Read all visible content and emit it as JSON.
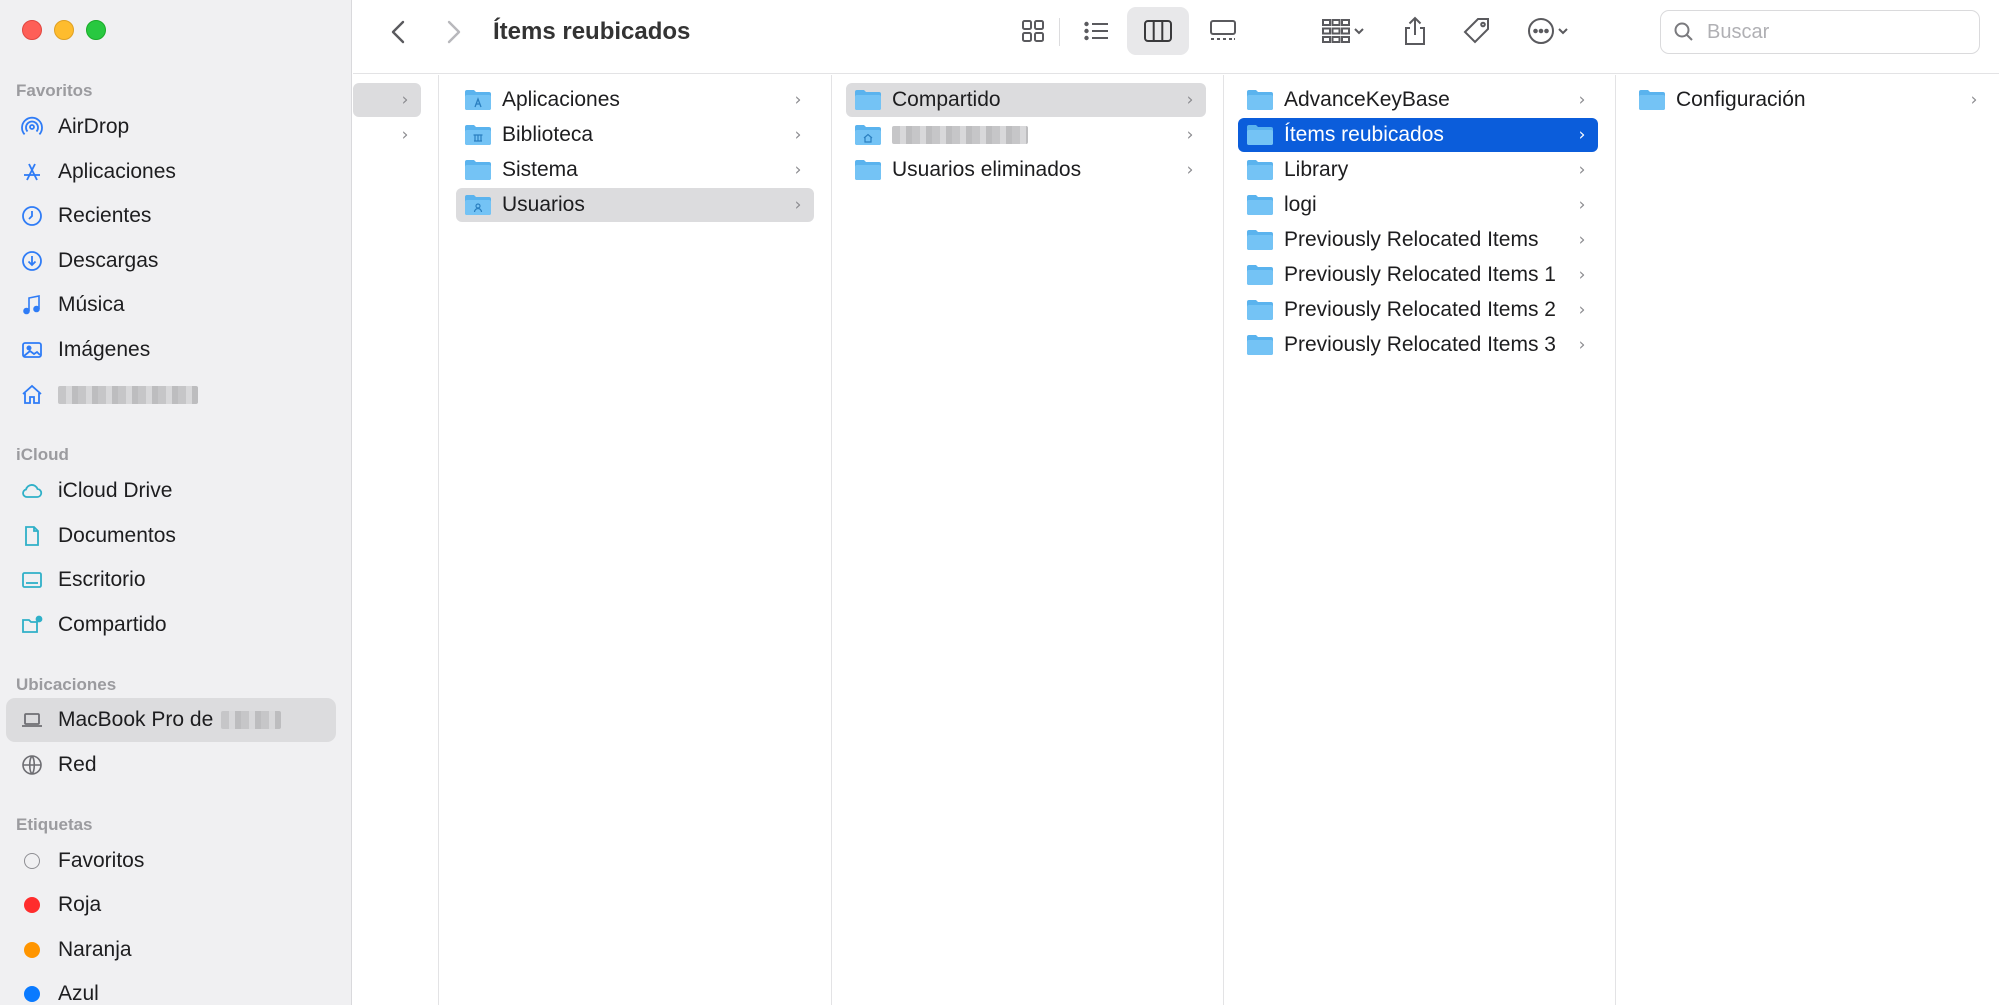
{
  "window": {
    "title": "Ítems reubicados"
  },
  "sidebar": {
    "sections": {
      "favorites": "Favoritos",
      "icloud": "iCloud",
      "locations": "Ubicaciones",
      "tags": "Etiquetas"
    },
    "favorites": [
      {
        "label": "AirDrop",
        "icon": "airdrop-icon"
      },
      {
        "label": "Aplicaciones",
        "icon": "applications-icon"
      },
      {
        "label": "Recientes",
        "icon": "clock-icon"
      },
      {
        "label": "Descargas",
        "icon": "download-icon"
      },
      {
        "label": "Música",
        "icon": "music-icon"
      },
      {
        "label": "Imágenes",
        "icon": "photo-icon"
      },
      {
        "label": "",
        "icon": "home-icon"
      }
    ],
    "icloud": [
      {
        "label": "iCloud Drive",
        "icon": "cloud-icon"
      },
      {
        "label": "Documentos",
        "icon": "document-icon"
      },
      {
        "label": "Escritorio",
        "icon": "desktop-icon"
      },
      {
        "label": "Compartido",
        "icon": "shared-folder-icon"
      }
    ],
    "locations": [
      {
        "label": "MacBook Pro de",
        "icon": "laptop-icon"
      },
      {
        "label": "Red",
        "icon": "network-icon"
      }
    ],
    "tags": [
      {
        "label": "Favoritos",
        "color": "none"
      },
      {
        "label": "Roja",
        "color": "#ff2d2d"
      },
      {
        "label": "Naranja",
        "color": "#ff9500"
      },
      {
        "label": "Azul",
        "color": "#0a7aff"
      }
    ]
  },
  "toolbar": {
    "back": "back-chevron-icon",
    "forward": "forward-chevron-icon",
    "view_modes": [
      "icon-view-icon",
      "list-view-icon",
      "column-view-icon",
      "gallery-view-icon"
    ],
    "active_view": "column-view-icon",
    "search_placeholder": "Buscar"
  },
  "columns": [
    {
      "items": [
        {
          "label": "",
          "selected": "grey"
        },
        {
          "label": ""
        }
      ]
    },
    {
      "items": [
        {
          "label": "Aplicaciones",
          "icon": "folder-apps-icon"
        },
        {
          "label": "Biblioteca",
          "icon": "folder-library-icon"
        },
        {
          "label": "Sistema",
          "icon": "folder-system-icon"
        },
        {
          "label": "Usuarios",
          "icon": "folder-users-icon",
          "selected": "grey"
        }
      ]
    },
    {
      "items": [
        {
          "label": "Compartido",
          "icon": "folder-icon",
          "selected": "grey"
        },
        {
          "label": "",
          "icon": "folder-home-icon"
        },
        {
          "label": "Usuarios eliminados",
          "icon": "folder-icon"
        }
      ]
    },
    {
      "items": [
        {
          "label": "AdvanceKeyBase"
        },
        {
          "label": "Ítems reubicados",
          "selected": "blue"
        },
        {
          "label": "Library"
        },
        {
          "label": "logi"
        },
        {
          "label": "Previously Relocated Items"
        },
        {
          "label": "Previously Relocated Items 1"
        },
        {
          "label": "Previously Relocated Items 2"
        },
        {
          "label": "Previously Relocated Items 3"
        }
      ]
    },
    {
      "items": [
        {
          "label": "Configuración"
        }
      ]
    }
  ]
}
